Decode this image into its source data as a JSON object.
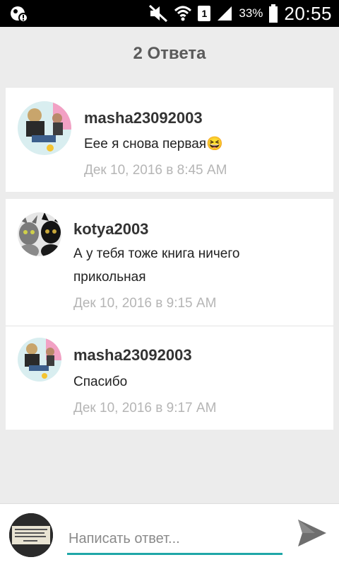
{
  "status_bar": {
    "battery_percent": "33%",
    "time": "20:55",
    "sim_number": "1"
  },
  "header": {
    "title": "2 Ответа"
  },
  "question": {
    "username": "masha23092003",
    "text": "Еее я снова первая😆",
    "timestamp": "Дек  10, 2016 в 8:45 AM"
  },
  "replies": [
    {
      "username": "kotya2003",
      "text_line1": "А у тебя тоже книга ничего",
      "text_line2": "прикольная",
      "timestamp": "Дек  10, 2016 в 9:15 AM"
    },
    {
      "username": "masha23092003",
      "text_line1": "Спасибо",
      "timestamp": "Дек  10, 2016 в 9:17 AM"
    }
  ],
  "composer": {
    "placeholder": "Написать ответ...",
    "send_icon": "send-icon"
  }
}
